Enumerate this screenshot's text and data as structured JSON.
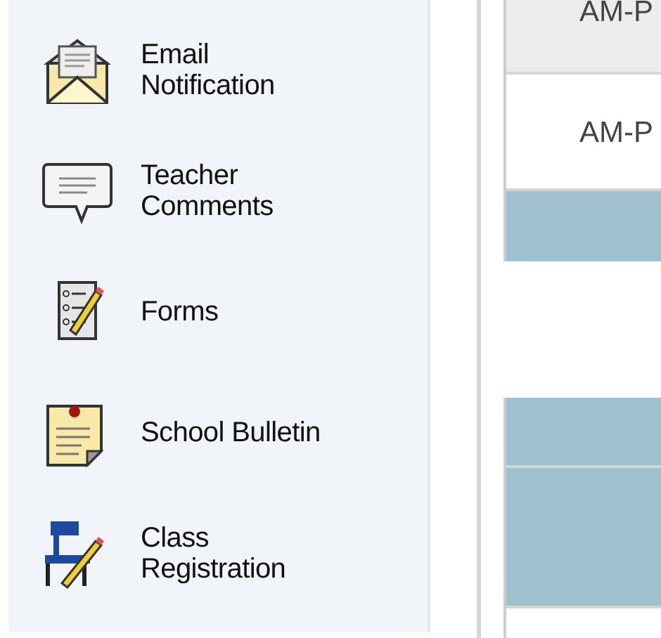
{
  "sidebar": {
    "items": [
      {
        "label": "Email\nNotification"
      },
      {
        "label": "Teacher\nComments"
      },
      {
        "label": "Forms"
      },
      {
        "label": "School Bulletin"
      },
      {
        "label": "Class\nRegistration"
      }
    ]
  },
  "tables": [
    {
      "rows": [
        {
          "kind": "header",
          "text": "AM-P"
        },
        {
          "kind": "row",
          "text": "AM-P"
        },
        {
          "kind": "short-band"
        }
      ]
    },
    {
      "rows": [
        {
          "kind": "short-band"
        },
        {
          "kind": "tall-band"
        },
        {
          "kind": "row"
        }
      ]
    }
  ]
}
